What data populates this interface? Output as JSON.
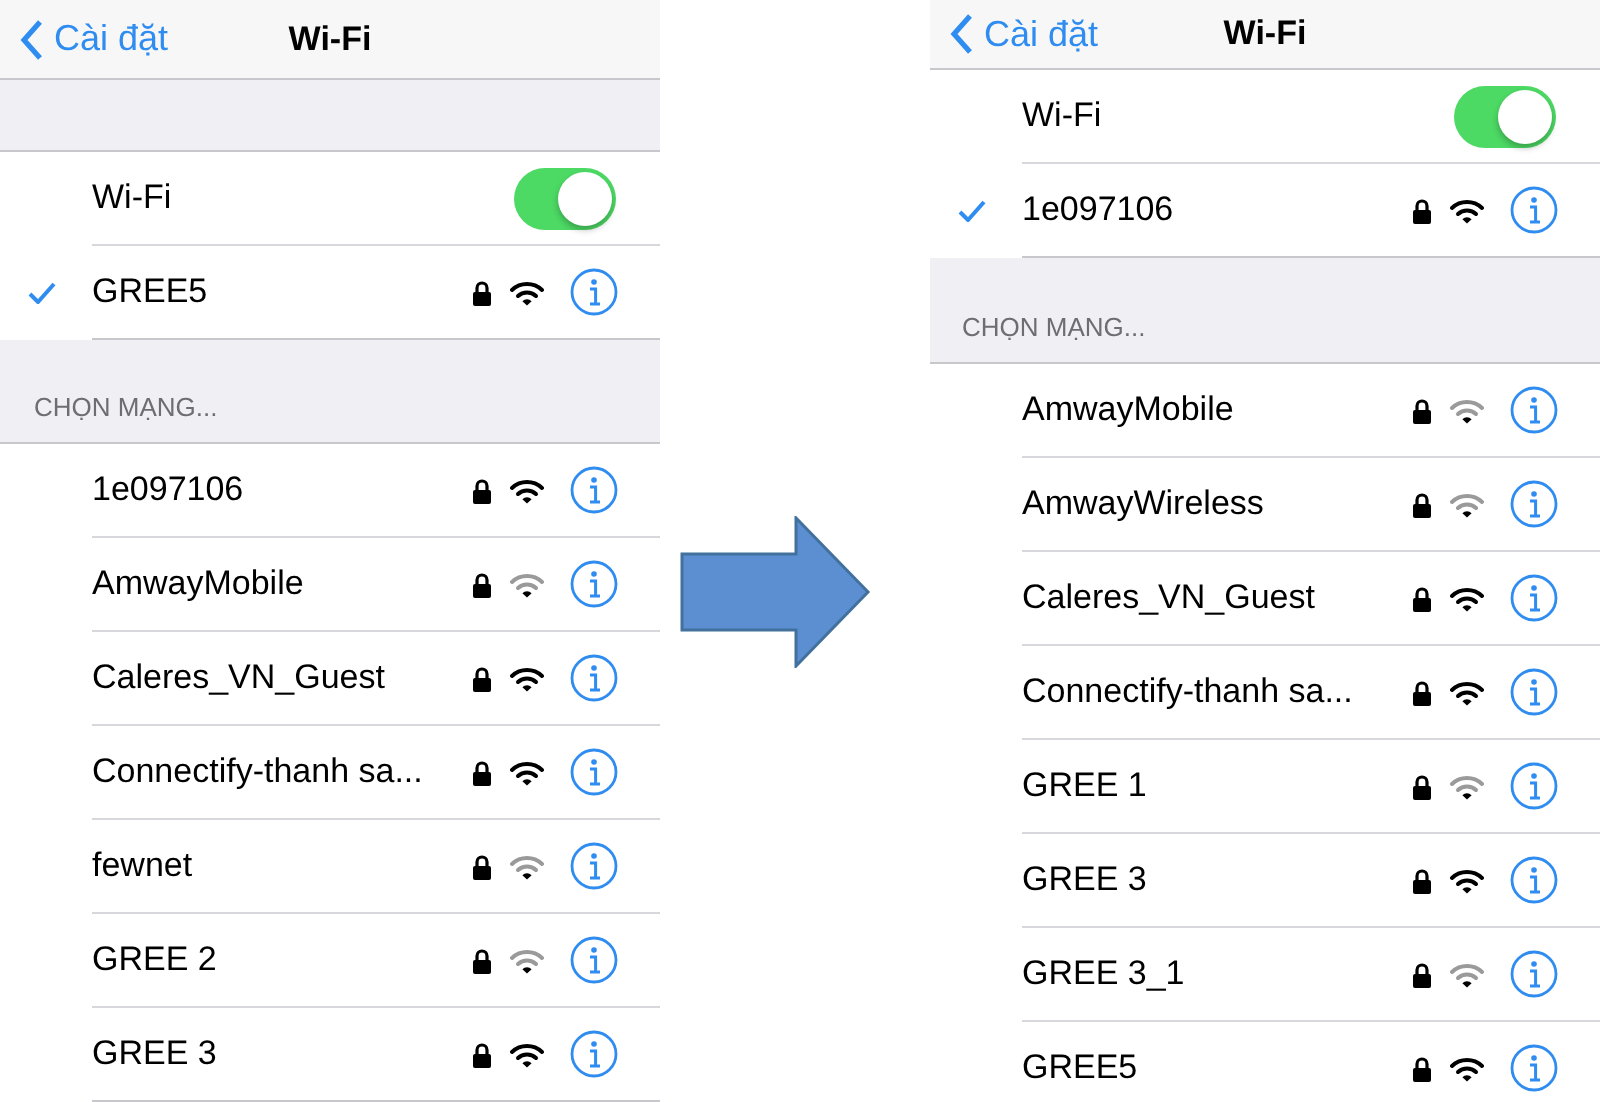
{
  "panels": [
    {
      "nav": {
        "back": "Cài đặt",
        "title": "Wi-Fi"
      },
      "wifi_toggle": {
        "label": "Wi-Fi",
        "on": true
      },
      "connected": {
        "name": "GREE5",
        "selected": true,
        "locked": true,
        "weak_signal": false
      },
      "section_header": "CHỌN MẠNG...",
      "networks": [
        {
          "name": "1e097106",
          "locked": true,
          "weak_signal": false
        },
        {
          "name": "AmwayMobile",
          "locked": true,
          "weak_signal": true
        },
        {
          "name": "Caleres_VN_Guest",
          "locked": true,
          "weak_signal": false
        },
        {
          "name": "Connectify-thanh sa...",
          "locked": true,
          "weak_signal": false
        },
        {
          "name": "fewnet",
          "locked": true,
          "weak_signal": true
        },
        {
          "name": "GREE 2",
          "locked": true,
          "weak_signal": true
        },
        {
          "name": "GREE 3",
          "locked": true,
          "weak_signal": false
        }
      ]
    },
    {
      "nav": {
        "back": "Cài đặt",
        "title": "Wi-Fi"
      },
      "wifi_toggle": {
        "label": "Wi-Fi",
        "on": true
      },
      "connected": {
        "name": "1e097106",
        "selected": true,
        "locked": true,
        "weak_signal": false
      },
      "section_header": "CHỌN MẠNG...",
      "networks": [
        {
          "name": "AmwayMobile",
          "locked": true,
          "weak_signal": true
        },
        {
          "name": "AmwayWireless",
          "locked": true,
          "weak_signal": true
        },
        {
          "name": "Caleres_VN_Guest",
          "locked": true,
          "weak_signal": false
        },
        {
          "name": "Connectify-thanh sa...",
          "locked": true,
          "weak_signal": false
        },
        {
          "name": "GREE 1",
          "locked": true,
          "weak_signal": true
        },
        {
          "name": "GREE 3",
          "locked": true,
          "weak_signal": false
        },
        {
          "name": "GREE 3_1",
          "locked": true,
          "weak_signal": true
        },
        {
          "name": "GREE5",
          "locked": true,
          "weak_signal": false
        }
      ]
    }
  ]
}
